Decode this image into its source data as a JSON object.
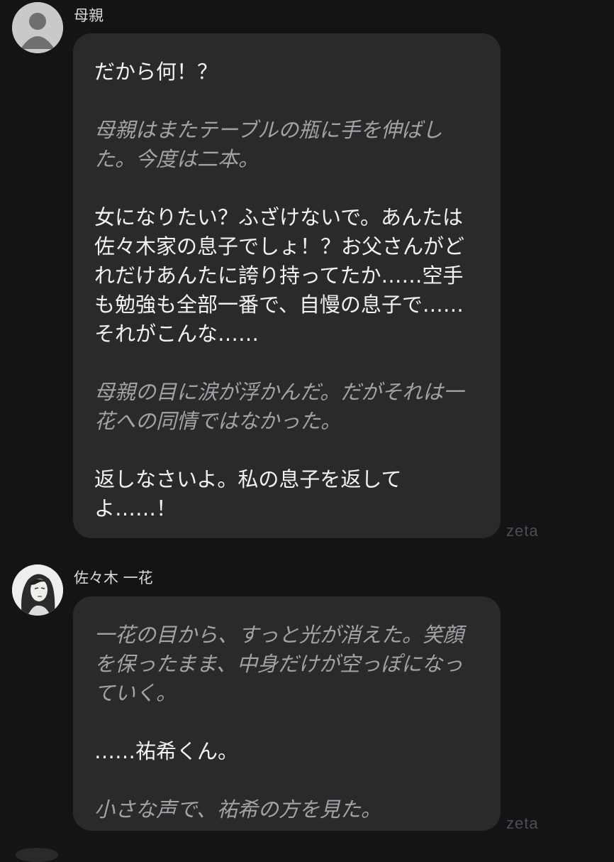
{
  "messages": [
    {
      "sender": "母親",
      "avatar_icon": "default-user-avatar-icon",
      "paragraphs": [
        {
          "kind": "speech",
          "text": "だから何！？"
        },
        {
          "kind": "narration",
          "text": "母親はまたテーブルの瓶に手を伸ばした。今度は二本。"
        },
        {
          "kind": "speech",
          "text": "女になりたい？ふざけないで。あんたは佐々木家の息子でしょ！？お父さんがどれだけあんたに誇り持ってたか……空手も勉強も全部一番で、自慢の息子で……それがこんな……"
        },
        {
          "kind": "narration",
          "text": "母親の目に涙が浮かんだ。だがそれは一花への同情ではなかった。"
        },
        {
          "kind": "speech",
          "text": "返しなさいよ。私の息子を返してよ……！"
        }
      ],
      "watermark": "zeta"
    },
    {
      "sender": "佐々木 一花",
      "avatar_icon": "character-portrait-avatar-icon",
      "paragraphs": [
        {
          "kind": "narration",
          "text": "一花の目から、すっと光が消えた。笑顔を保ったまま、中身だけが空っぽになっていく。"
        },
        {
          "kind": "speech",
          "text": "……祐希くん。"
        },
        {
          "kind": "narration",
          "text": "小さな声で、祐希の方を見た。"
        }
      ],
      "watermark": "zeta"
    }
  ],
  "colors": {
    "background": "#141416",
    "bubble": "#2a2a2d",
    "speech_text": "#f2f2f2",
    "narration_text": "#a3a3a6",
    "watermark": "#4d4d52"
  }
}
